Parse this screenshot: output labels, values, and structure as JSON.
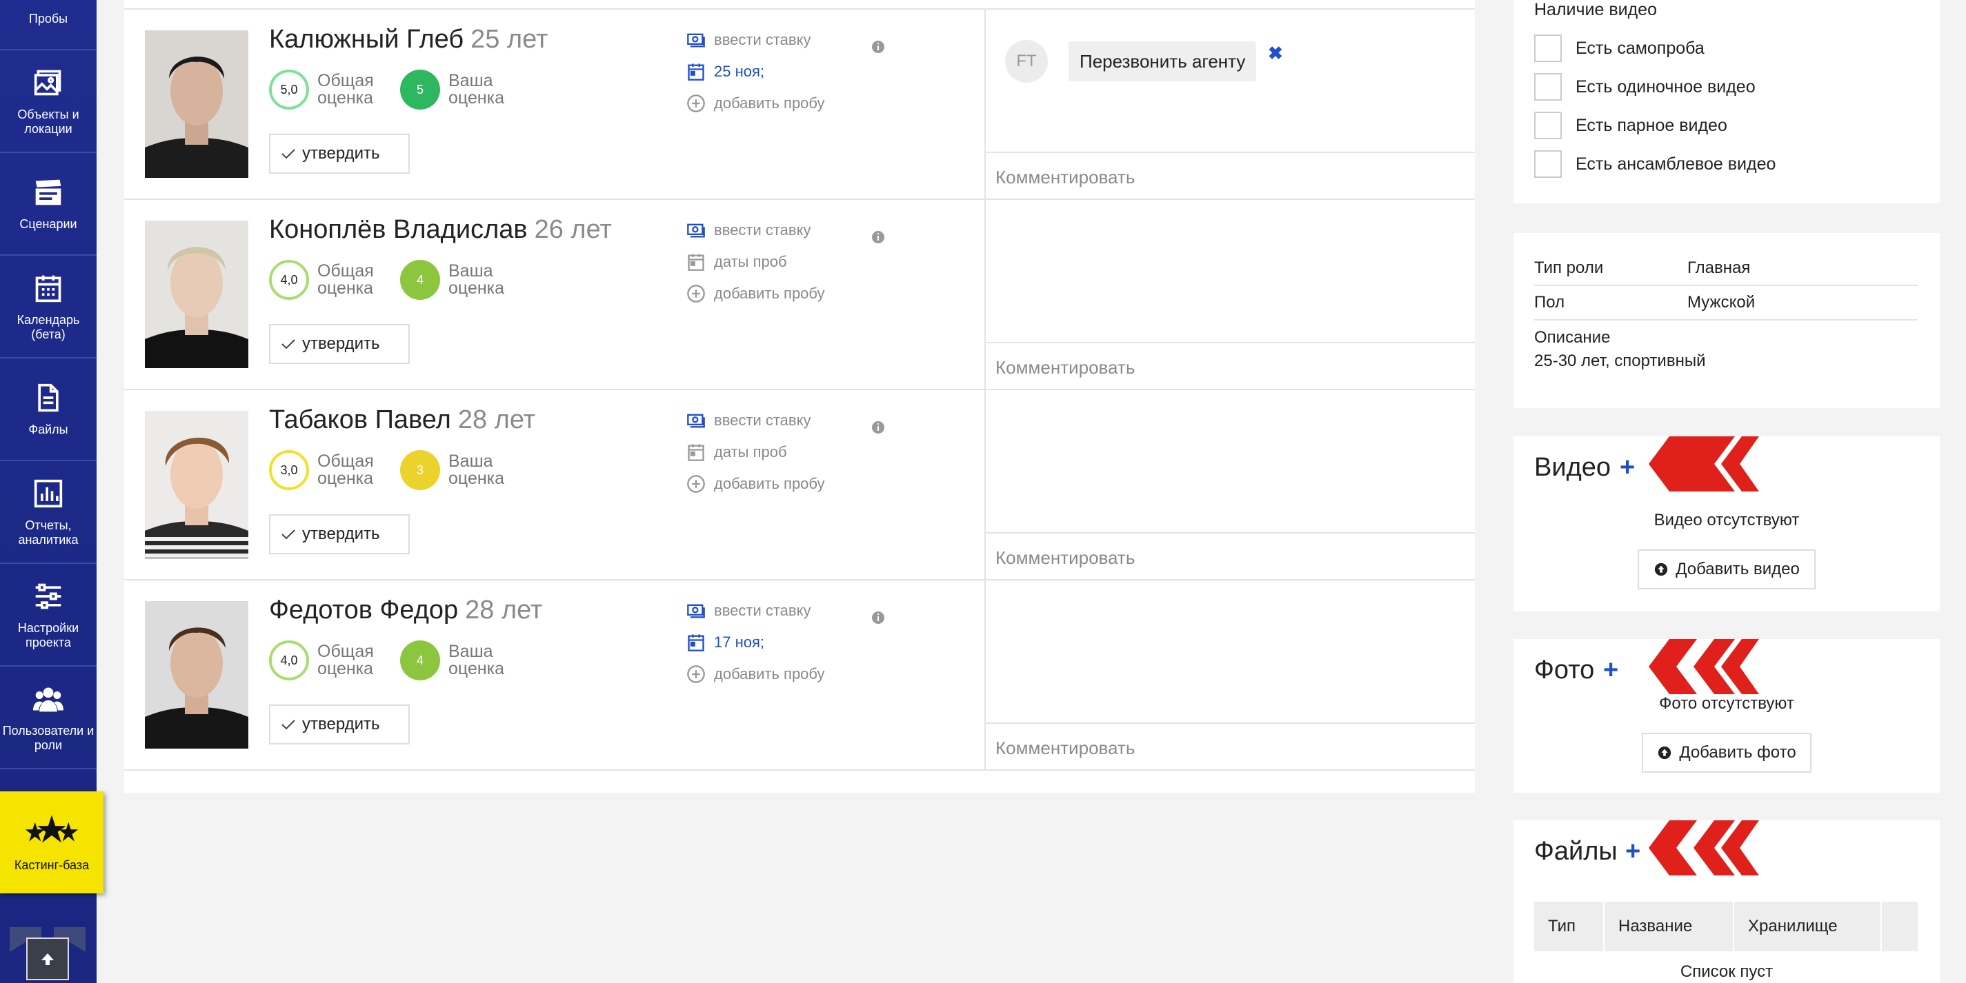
{
  "sidebar": {
    "items": [
      {
        "label": "Пробы",
        "icon": "video-camera-icon"
      },
      {
        "label": "Объекты и локации",
        "icon": "image-icon"
      },
      {
        "label": "Сценарии",
        "icon": "clapperboard-icon"
      },
      {
        "label": "Календарь (бета)",
        "icon": "calendar-icon"
      },
      {
        "label": "Файлы",
        "icon": "file-icon"
      },
      {
        "label": "Отчеты, аналитика",
        "icon": "bar-chart-icon"
      },
      {
        "label": "Настройки проекта",
        "icon": "sliders-icon"
      },
      {
        "label": "Пользователи и роли",
        "icon": "users-icon"
      },
      {
        "label": "Кастинг-база",
        "icon": "stars-icon",
        "active": true
      }
    ]
  },
  "actors": [
    {
      "name": "Калюжный Глеб",
      "age": "25 лет",
      "overall_score": "5,0",
      "overall_label": "Общая оценка",
      "overall_color": "#2fbf5a",
      "your_score": "5",
      "your_label": "Ваша оценка",
      "your_color": "#2db860",
      "approve_label": "утвердить",
      "rate_label": "ввести ставку",
      "date_label": "25 ноя;",
      "date_set": true,
      "add_probe_label": "добавить пробу",
      "comment_placeholder": "Комментировать",
      "note": {
        "author_initials": "FT",
        "text": "Перезвонить агенту",
        "close": "✖"
      }
    },
    {
      "name": "Коноплёв Владислав",
      "age": "26 лет",
      "overall_score": "4,0",
      "overall_label": "Общая оценка",
      "overall_color": "#8dcc2a",
      "your_score": "4",
      "your_label": "Ваша оценка",
      "your_color": "#8cc63f",
      "approve_label": "утвердить",
      "rate_label": "ввести ставку",
      "date_label": "даты проб",
      "date_set": false,
      "add_probe_label": "добавить пробу",
      "comment_placeholder": "Комментировать"
    },
    {
      "name": "Табаков Павел",
      "age": "28 лет",
      "overall_score": "3,0",
      "overall_label": "Общая оценка",
      "overall_color": "#f2e12a",
      "your_score": "3",
      "your_label": "Ваша оценка",
      "your_color": "#ecd32c",
      "approve_label": "утвердить",
      "rate_label": "ввести ставку",
      "date_label": "даты проб",
      "date_set": false,
      "add_probe_label": "добавить пробу",
      "comment_placeholder": "Комментировать"
    },
    {
      "name": "Федотов Федор",
      "age": "28 лет",
      "overall_score": "4,0",
      "overall_label": "Общая оценка",
      "overall_color": "#8dcc2a",
      "your_score": "4",
      "your_label": "Ваша оценка",
      "your_color": "#8cc63f",
      "approve_label": "утвердить",
      "rate_label": "ввести ставку",
      "date_label": "17 ноя;",
      "date_set": true,
      "add_probe_label": "добавить пробу",
      "comment_placeholder": "Комментировать"
    }
  ],
  "video_filter": {
    "title": "Наличие видео",
    "options": [
      "Есть самопроба",
      "Есть одиночное видео",
      "Есть парное видео",
      "Есть ансамблевое видео"
    ]
  },
  "role_info": {
    "rows": [
      {
        "key": "Тип роли",
        "value": "Главная"
      },
      {
        "key": "Пол",
        "value": "Мужской"
      },
      {
        "key": "Описание",
        "value": ""
      }
    ],
    "description": "25-30 лет, спортивный"
  },
  "video_section": {
    "title": "Видео",
    "plus": "+",
    "empty": "Видео отсутствуют",
    "add_label": "Добавить видео"
  },
  "photo_section": {
    "title": "Фото",
    "plus": "+",
    "empty": "Фото отсутствуют",
    "add_label": "Добавить фото"
  },
  "files_section": {
    "title": "Файлы",
    "plus": "+",
    "columns": [
      "Тип",
      "Название",
      "Хранилище"
    ],
    "empty": "Список пуст"
  },
  "colors": {
    "sidebar": "#1e2b8a",
    "active_nav": "#f5e400",
    "link": "#1e4fcc",
    "chevron": "#e0201b"
  }
}
